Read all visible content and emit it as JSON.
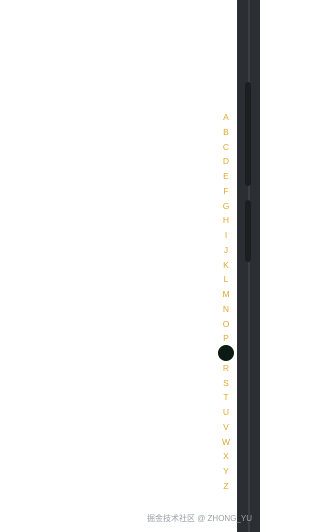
{
  "index_bar": {
    "letters": [
      "A",
      "B",
      "C",
      "D",
      "E",
      "F",
      "G",
      "H",
      "I",
      "J",
      "K",
      "L",
      "M",
      "N",
      "O",
      "P",
      "Q",
      "R",
      "S",
      "T",
      "U",
      "V",
      "W",
      "X",
      "Y",
      "Z"
    ],
    "active_letter": "Q",
    "letter_color": "#e0a82e",
    "active_indicator_color": "#0b1a12"
  },
  "watermark": {
    "text": "掘金技术社区 @ ZHONG_YU"
  }
}
